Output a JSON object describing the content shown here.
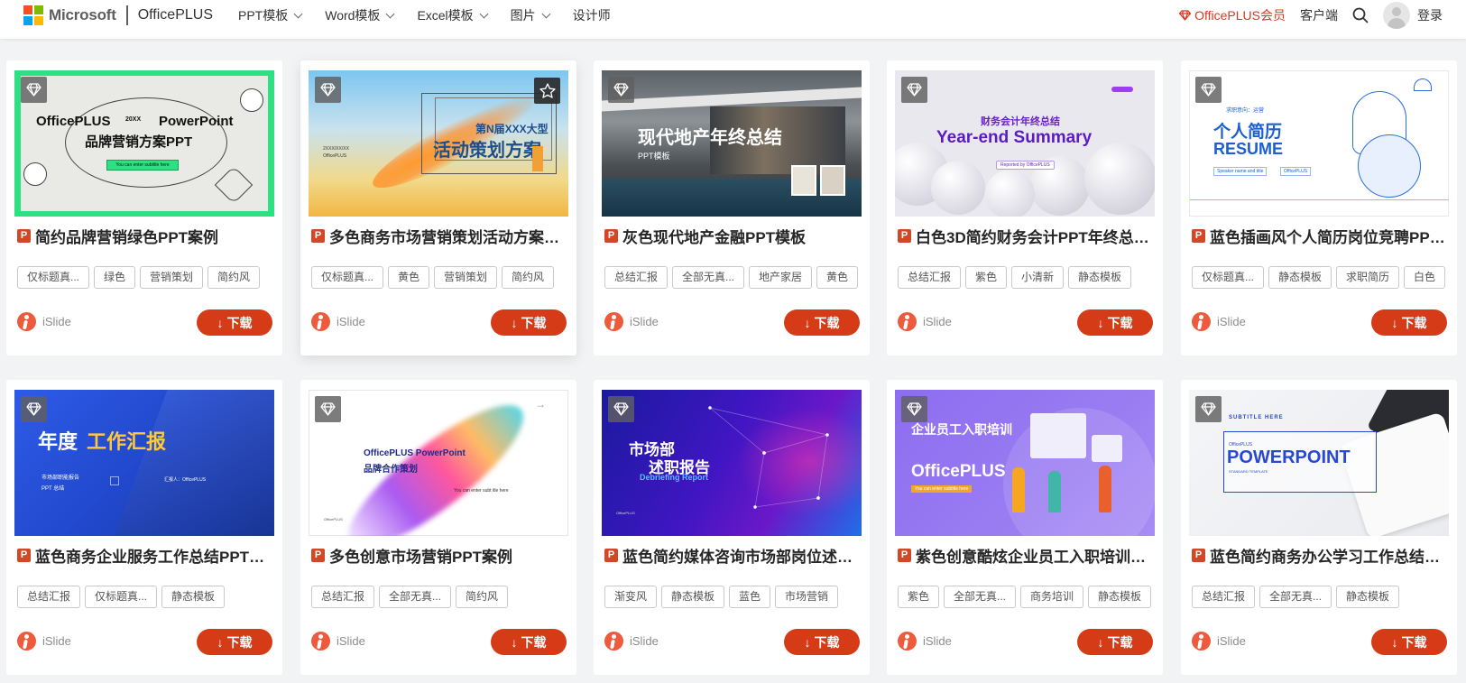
{
  "header": {
    "brand": "Microsoft",
    "product": "OfficePLUS",
    "nav": [
      {
        "label": "PPT模板",
        "dropdown": true
      },
      {
        "label": "Word模板",
        "dropdown": true
      },
      {
        "label": "Excel模板",
        "dropdown": true
      },
      {
        "label": "图片",
        "dropdown": true
      },
      {
        "label": "设计师",
        "dropdown": false
      }
    ],
    "vip_label": "OfficePLUS会员",
    "client_label": "客户端",
    "login_label": "登录"
  },
  "colors": {
    "accent": "#d43b16",
    "vip": "#d9381e",
    "ppt_badge": "#d24726",
    "ms_red": "#f25022",
    "ms_green": "#7fba00",
    "ms_blue": "#00a4ef",
    "ms_yellow": "#ffb900"
  },
  "download_label": "下载",
  "author_name": "iSlide",
  "cards": [
    {
      "title": "简约品牌营销绿色PPT案例",
      "tags": [
        "仅标题真...",
        "绿色",
        "营销策划",
        "简约风"
      ],
      "thumb": {
        "line1": "OfficePLUS",
        "small": "20XX",
        "line1b": "PowerPoint",
        "line2": "品牌营销方案PPT",
        "sub": "You can enter subtitle here"
      }
    },
    {
      "title": "多色商务市场营销策划活动方案PP...",
      "tags": [
        "仅标题真...",
        "黄色",
        "营销策划",
        "简约风"
      ],
      "thumb": {
        "line1": "第N届XXX大型",
        "line2": "活动策划方案",
        "small": "2XXX/XX/XX",
        "brand": "OfficePLUS"
      }
    },
    {
      "title": "灰色现代地产金融PPT模板",
      "tags": [
        "总结汇报",
        "全部无真...",
        "地产家居",
        "黄色"
      ],
      "thumb": {
        "line1": "现代地产年终总结",
        "line2": "PPT模板"
      }
    },
    {
      "title": "白色3D简约财务会计PPT年终总结...",
      "tags": [
        "总结汇报",
        "紫色",
        "小清新",
        "静态模板"
      ],
      "thumb": {
        "line1": "财务会计年终总结",
        "line2": "Year-end Summary",
        "small": "Reported by OfficePLUS"
      }
    },
    {
      "title": "蓝色插画风个人简历岗位竞聘PPT...",
      "tags": [
        "仅标题真...",
        "静态模板",
        "求职简历",
        "白色"
      ],
      "thumb": {
        "line1": "个人简历",
        "line2": "RESUME",
        "small": "求职意向：运营",
        "sub1": "Speaker name and title",
        "sub2": "OfficePLUS"
      }
    },
    {
      "title": "蓝色商务企业服务工作总结PPT案例",
      "tags": [
        "总结汇报",
        "仅标题真...",
        "静态模板"
      ],
      "thumb": {
        "line1a": "年度",
        "line1b": "工作汇报",
        "line2": "市场部职能报告",
        "line3": "PPT 总结",
        "small": "汇报人：OfficePLUS"
      }
    },
    {
      "title": "多色创意市场营销PPT案例",
      "tags": [
        "总结汇报",
        "全部无真...",
        "简约风"
      ],
      "thumb": {
        "line1": "OfficePLUS PowerPoint",
        "line2": "品牌合作策划",
        "sub": "You can enter subt itle here",
        "small": "OfficePLUS"
      }
    },
    {
      "title": "蓝色简约媒体咨询市场部岗位述职...",
      "tags": [
        "渐变风",
        "静态模板",
        "蓝色",
        "市场营销"
      ],
      "thumb": {
        "line1": "市场部",
        "line2": "述职报告",
        "line3": "Debriefing Report",
        "small": "OfficePLUS"
      }
    },
    {
      "title": "紫色创意酷炫企业员工入职培训PP...",
      "tags": [
        "紫色",
        "全部无真...",
        "商务培训",
        "静态模板"
      ],
      "thumb": {
        "line1": "企业员工入职培训",
        "line2": "OfficePLUS",
        "sub": "You can enter subtitle here"
      }
    },
    {
      "title": "蓝色简约商务办公学习工作总结PP...",
      "tags": [
        "总结汇报",
        "全部无真...",
        "静态模板"
      ],
      "thumb": {
        "small1": "SUBTITLE HERE",
        "small2": "OfficePLUS",
        "line1": "POWERPOINT",
        "small3": "STANDARD TEMPLATE"
      }
    }
  ]
}
